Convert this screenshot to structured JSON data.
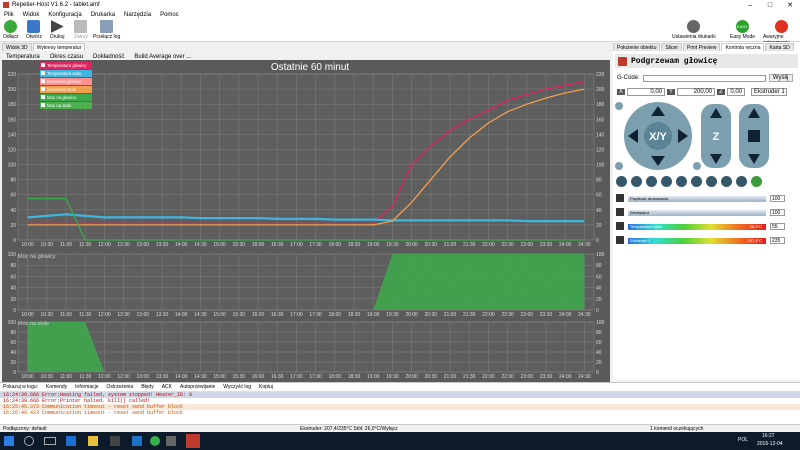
{
  "window": {
    "title": "Repetier-Host V1.6.2 - tablet.amf"
  },
  "menu": [
    "Plik",
    "Widok",
    "Konfiguracja",
    "Drukarka",
    "Narzędzia",
    "Pomoc"
  ],
  "toolbar": {
    "connect": "Odłącz",
    "open": "Otwórz",
    "print": "Drukuj",
    "pause": "Zatrzy",
    "showlog": "Przełącz log",
    "printer_settings": "Ustawienia drukarki",
    "easy": "Easy Mode",
    "easy_badge": "EASY",
    "emergency": "Awaryjne zatrzymanie"
  },
  "left_tabs": [
    "Widok 3D",
    "Wykresy temperatur"
  ],
  "sub_tabs": [
    "Temperatura",
    "Okres czasu",
    "Dokładność",
    "Build Average over ..."
  ],
  "chart": {
    "title": "Ostatnie 60 minut"
  },
  "legend": [
    "Temperatura głowicy",
    "Temperatura stołu",
    "Docelowa głowicy",
    "Docelowa stołu",
    "Moc na głowicy",
    "Moc na stole"
  ],
  "legend_colors": [
    "#e0245e",
    "#3fb6e0",
    "#ff9090",
    "#f0a050",
    "#3caa4a",
    "#4caf50"
  ],
  "chart_data": [
    {
      "type": "line",
      "title": "Ostatnie 60 minut",
      "x": [
        "10:00",
        "10:30",
        "11:00",
        "11:30",
        "12:00",
        "12:30",
        "13:00",
        "13:30",
        "14:00",
        "14:30",
        "15:00",
        "15:30",
        "16:00",
        "16:30",
        "17:00",
        "17:30",
        "18:00",
        "18:30",
        "19:00",
        "19:30",
        "20:00",
        "20:30",
        "21:00",
        "21:30",
        "22:00",
        "22:30",
        "23:00",
        "23:30",
        "24:00",
        "24:30"
      ],
      "ylim": [
        0,
        220
      ],
      "yticks": [
        0,
        20,
        40,
        60,
        80,
        100,
        120,
        140,
        160,
        180,
        200,
        220
      ],
      "series": [
        {
          "name": "Temperatura głowicy",
          "values": [
            22,
            22,
            22,
            22,
            22,
            22,
            22,
            22,
            22,
            22,
            22,
            22,
            22,
            22,
            22,
            22,
            22,
            22,
            22,
            45,
            100,
            125,
            145,
            160,
            172,
            185,
            193,
            200,
            205,
            210
          ]
        },
        {
          "name": "Temperatura stołu",
          "values": [
            30,
            32,
            34,
            32,
            30,
            30,
            30,
            30,
            30,
            29,
            29,
            29,
            29,
            28,
            28,
            28,
            27,
            27,
            27,
            26,
            26,
            26,
            26,
            26,
            26,
            26,
            25,
            25,
            25,
            25
          ]
        },
        {
          "name": "Docelowa stołu",
          "values": [
            20,
            20,
            20,
            20,
            20,
            20,
            20,
            20,
            20,
            20,
            20,
            20,
            20,
            20,
            20,
            20,
            20,
            20,
            20,
            25,
            50,
            80,
            110,
            135,
            155,
            170,
            180,
            188,
            195,
            200
          ]
        },
        {
          "name": "Moc na głowicy",
          "values": [
            55,
            55,
            55,
            0,
            0,
            0,
            0,
            0,
            0,
            0,
            0,
            0,
            0,
            0,
            0,
            0,
            0,
            0,
            0,
            0,
            0,
            0,
            0,
            0,
            0,
            0,
            0,
            0,
            0,
            0
          ]
        }
      ]
    },
    {
      "type": "area",
      "title": "Moc na głowicy",
      "x": [
        "10:00",
        "10:30",
        "11:00",
        "11:30",
        "12:00",
        "12:30",
        "13:00",
        "13:30",
        "14:00",
        "14:30",
        "15:00",
        "15:30",
        "16:00",
        "16:30",
        "17:00",
        "17:30",
        "18:00",
        "18:30",
        "19:00",
        "19:30",
        "20:00",
        "20:30",
        "21:00",
        "21:30",
        "22:00",
        "22:30",
        "23:00",
        "23:30",
        "24:00",
        "24:30"
      ],
      "ylim": [
        0,
        100
      ],
      "yticks": [
        0,
        20,
        40,
        60,
        80,
        100
      ],
      "series": [
        {
          "name": "Moc na głowicy",
          "values": [
            0,
            0,
            0,
            0,
            0,
            0,
            0,
            0,
            0,
            0,
            0,
            0,
            0,
            0,
            0,
            0,
            0,
            0,
            0,
            100,
            100,
            100,
            100,
            100,
            100,
            100,
            100,
            100,
            100,
            100
          ]
        }
      ]
    },
    {
      "type": "area",
      "title": "Moc na stole",
      "x": [
        "10:00",
        "10:30",
        "11:00",
        "11:30",
        "12:00",
        "12:30",
        "13:00",
        "13:30",
        "14:00",
        "14:30",
        "15:00",
        "15:30",
        "16:00",
        "16:30",
        "17:00",
        "17:30",
        "18:00",
        "18:30",
        "19:00",
        "19:30",
        "20:00",
        "20:30",
        "21:00",
        "21:30",
        "22:00",
        "22:30",
        "23:00",
        "23:30",
        "24:00",
        "24:30"
      ],
      "ylim": [
        0,
        100
      ],
      "yticks": [
        0,
        20,
        40,
        60,
        80,
        100
      ],
      "series": [
        {
          "name": "Moc na stole",
          "values": [
            100,
            100,
            100,
            100,
            0,
            0,
            0,
            0,
            0,
            0,
            0,
            0,
            0,
            0,
            0,
            0,
            0,
            0,
            0,
            0,
            0,
            0,
            0,
            0,
            0,
            0,
            0,
            0,
            0,
            0
          ]
        }
      ]
    }
  ],
  "panel_labels": {
    "head": "Moc na głowicy",
    "bed": "Moc na stole"
  },
  "right_tabs": [
    "Położenie obiektu",
    "Slicer",
    "Print Preview",
    "Kontrola ręczna",
    "Karta SD"
  ],
  "right": {
    "heading": "Podgrzewam głowicę",
    "gcode_label": "G-Code:",
    "send": "Wyślij",
    "x": "0,00",
    "y": "200,00",
    "z": "0,00",
    "extruder": "Ekstruder 1",
    "fan_label": "Prędkość drukowania",
    "fan_val": "100",
    "flow_label": "Wentylator",
    "flow_val": "100",
    "bed_label": "Temperatura stołu",
    "bed_val": "55",
    "bed_now": "26,3°C",
    "ext_label": "Ekstruder 1",
    "ext_val": "235",
    "ext_now": "207,4°C"
  },
  "log": {
    "tabs": [
      "Pokazuj w logu:",
      "Komendy",
      "Informacje",
      "Ostrzeżenia",
      "Błędy",
      "ACK",
      "Autoprzewijanie",
      "Wyczyść log",
      "Kopiuj"
    ],
    "lines": [
      {
        "t": "16:24:39.666",
        "m": "Error:Heating failed, system stopped! Heater_ID: 0"
      },
      {
        "t": "16:24:39.666",
        "m": "Error:Printer halted. kill() called!"
      },
      {
        "t": "16:25:45.373",
        "m": "Communication timeout - reset send buffer block"
      },
      {
        "t": "16:26:49.423",
        "m": "Communication timeout - reset send buffer block"
      }
    ]
  },
  "status": {
    "left": "Podłączony: default",
    "mid": "Ekstruder: 207,4/235°C Stół: 26,0°C/Wyłącz",
    "right": "1 komend oczekujących"
  },
  "taskbar": {
    "time": "16:27",
    "date": "2016-12-04",
    "lang": "POL"
  }
}
